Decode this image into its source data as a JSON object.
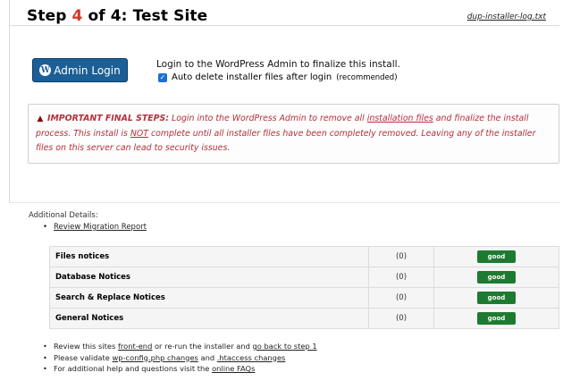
{
  "header": {
    "title_prefix": "Step ",
    "title_num": "4",
    "title_suffix": " of 4: Test Site",
    "log_link": "dup-installer-log.txt"
  },
  "admin_login": {
    "button_label": "Admin Login",
    "icon": "wordpress-icon",
    "description": "Login to the WordPress Admin to finalize this install.",
    "auto_delete_label": "Auto delete installer files after login",
    "auto_delete_checked": true,
    "recommended": "(recommended)"
  },
  "warning": {
    "icon": "warning-icon",
    "heading": "IMPORTANT FINAL STEPS:",
    "text_1": " Login into the WordPress Admin to remove all ",
    "link_1": "installation files",
    "text_2": " and finalize the install process. This install is ",
    "not_word": "NOT",
    "text_3": " complete until all installer files have been completely removed. Leaving any of the installer files on this server can lead to security issues."
  },
  "details": {
    "label": "Additional Details:",
    "review_link": "Review Migration Report"
  },
  "notices": [
    {
      "name": "Files notices",
      "count": "(0)",
      "status": "good"
    },
    {
      "name": "Database Notices",
      "count": "(0)",
      "status": "good"
    },
    {
      "name": "Search & Replace Notices",
      "count": "(0)",
      "status": "good"
    },
    {
      "name": "General Notices",
      "count": "(0)",
      "status": "good"
    }
  ],
  "footer_list": {
    "item1_text1": "Review this sites ",
    "item1_link1": "front-end",
    "item1_text2": " or re-run the installer and ",
    "item1_link2": "go back to step 1",
    "item2_text1": "Please validate ",
    "item2_link1": "wp-config.php changes",
    "item2_text2": " and ",
    "item2_link2": ".htaccess changes",
    "item3_text1": "For additional help and questions visit the ",
    "item3_link1": "online FAQs"
  },
  "colors": {
    "accent_red": "#d03a2b",
    "button_blue": "#1b5f96",
    "warning_red": "#b4303d",
    "good_green": "#1e7a30"
  }
}
